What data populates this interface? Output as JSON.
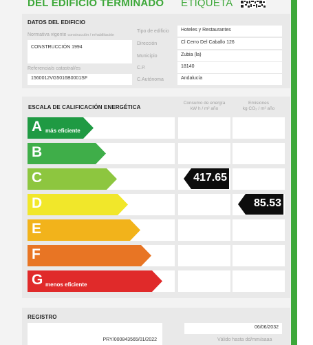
{
  "header": {
    "left_title": "DEL EDIFICIO TERMINADO",
    "right_title": "ETIQUETA"
  },
  "datos": {
    "title": "DATOS DEL EDIFICIO",
    "normativa_label": "Normativa vigente",
    "normativa_sublabel": "construcción / rehabilitación",
    "normativa_value": "CONSTRUCCIÓN 1994",
    "referencia_label": "Referencia/s catastral/es",
    "referencia_value": "1560012VG5016B0001SF",
    "tipo_label": "Tipo de edificio",
    "tipo_value": "Hoteles y Restaurantes",
    "direccion_label": "Dirección",
    "direccion_value": "Cl Cerro Del Caballo 126",
    "municipio_label": "Municipio",
    "municipio_value": "Zubia (la)",
    "cp_label": "C.P.",
    "cp_value": "18140",
    "ca_label": "C.Autónoma",
    "ca_value": "Andalucía"
  },
  "escala": {
    "title": "ESCALA DE CALIFICACIÓN ENERGÉTICA",
    "col_consumo_line1": "Consumo de energía",
    "col_consumo_line2": "kW h / m² año",
    "col_emisiones_line1": "Emisiones",
    "col_emisiones_line2": "kg CO₂ / m² año",
    "classes": [
      {
        "letter": "A",
        "sub": "más eficiente",
        "color": "#1f9a43"
      },
      {
        "letter": "B",
        "sub": "",
        "color": "#3fae49"
      },
      {
        "letter": "C",
        "sub": "",
        "color": "#8dc63f"
      },
      {
        "letter": "D",
        "sub": "",
        "color": "#f1e72a"
      },
      {
        "letter": "E",
        "sub": "",
        "color": "#f2b31b"
      },
      {
        "letter": "F",
        "sub": "",
        "color": "#e87524"
      },
      {
        "letter": "G",
        "sub": "menos eficiente",
        "color": "#e02a2a"
      }
    ],
    "consumo": {
      "value": "417.65",
      "class": "C"
    },
    "emisiones": {
      "value": "85.53",
      "class": "D"
    }
  },
  "registro": {
    "title": "REGISTRO",
    "number": "PRY/000843565/01/2022",
    "valid_date": "06/06/2032",
    "valid_label": "Válido hasta dd/mm/aaaa"
  }
}
